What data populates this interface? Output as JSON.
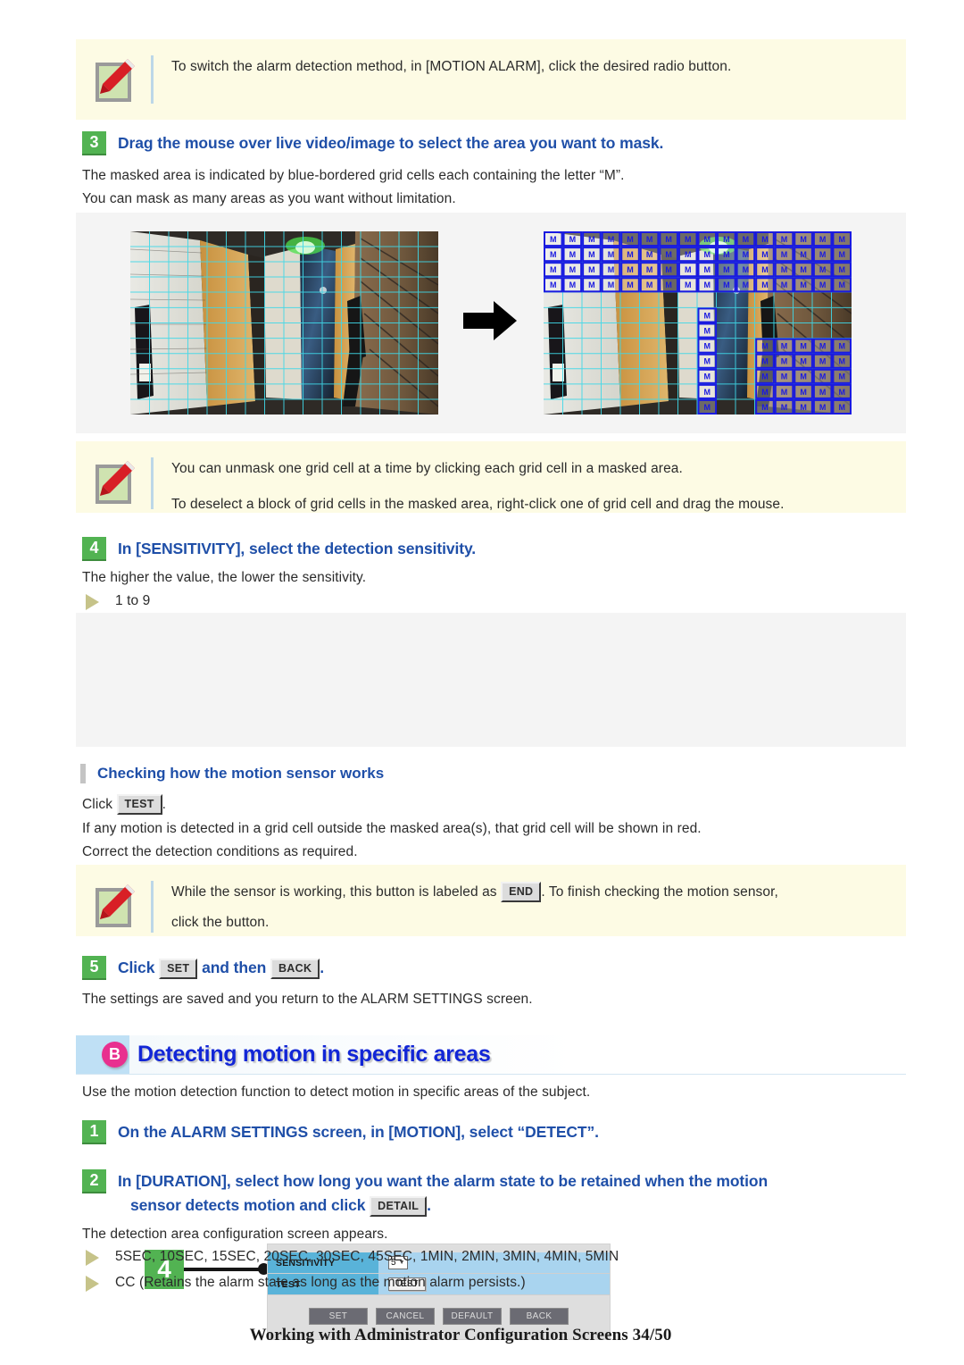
{
  "notes": [
    {
      "id": "note-radio-button",
      "icon": "pencil-note-icon",
      "lines": [
        "To switch the alarm detection method, in [MOTION ALARM], click the desired radio button."
      ]
    },
    {
      "id": "note-unmask",
      "icon": "pencil-note-icon",
      "lines": [
        "You can unmask one grid cell at a time by clicking each grid cell in a masked area.",
        "To deselect a block of grid cells in the masked area, right-click one of grid cell and drag the mouse."
      ]
    },
    {
      "id": "note-end-button",
      "icon": "pencil-note-icon",
      "line_before": "While the sensor is working, this button is labeled as",
      "button": "END",
      "line_after": ". To finish checking the motion sensor,",
      "line2": "click the button."
    }
  ],
  "step3": {
    "number": "3",
    "title": "Drag the mouse over live video/image to select the area you want to mask.",
    "body": [
      "The masked area is indicated by blue-bordered grid cells each containing the letter “M”.",
      "You can mask as many areas as you want without limitation."
    ]
  },
  "figure_masking": {
    "name": "masking-example-figure",
    "left_caption": "live video with detection grid",
    "right_caption": "live video with masked cells marked M",
    "arrow": "right-arrow-icon",
    "mask_letter": "M",
    "grid_cols": 16,
    "grid_rows": 12
  },
  "step4": {
    "number": "4",
    "title": "In [SENSITIVITY], select the detection sensitivity.",
    "body": [
      "The higher the value, the lower the sensitivity."
    ],
    "bullets": [
      "1 to 9"
    ]
  },
  "sensitivity_panel": {
    "callout": "4",
    "rows": [
      {
        "label": "SENSITIVITY",
        "control": "select",
        "value": "5"
      },
      {
        "label": "TEST",
        "control": "button",
        "value": "TEST"
      }
    ],
    "actions": [
      "SET",
      "CANCEL",
      "DEFAULT",
      "BACK"
    ]
  },
  "checking_section": {
    "heading": "Checking how the motion sensor works",
    "click_label": "Click",
    "click_button": "TEST",
    "click_period": ".",
    "body": [
      "If any motion is detected in a grid cell outside the masked area(s), that grid cell will be shown in red.",
      "Correct the detection conditions as required."
    ]
  },
  "step5": {
    "number": "5",
    "title_a": "Click",
    "button_a": "SET",
    "title_b": "and then",
    "button_b": "BACK",
    "title_c": ".",
    "body": [
      "The settings are saved and you return to the ALARM SETTINGS screen."
    ]
  },
  "section_b": {
    "badge": "B",
    "title": "Detecting motion in specific areas",
    "intro": "Use the motion detection function to detect motion in specific areas of the subject."
  },
  "stepB1": {
    "number": "1",
    "title": "On the ALARM SETTINGS screen, in [MOTION], select “DETECT”."
  },
  "stepB2": {
    "number": "2",
    "title_line1": "In [DURATION], select how long you want the alarm state to be retained when the motion",
    "title_line2": "sensor detects motion and click",
    "button": "DETAIL",
    "title_after": ".",
    "body": [
      "The detection area configuration screen appears."
    ],
    "bullets": [
      "5SEC, 10SEC, 15SEC, 20SEC, 30SEC, 45SEC, 1MIN, 2MIN, 3MIN, 4MIN, 5MIN",
      "CC (Retains the alarm state as long as the motion alarm persists.)"
    ]
  },
  "footer": {
    "text": "Working with Administrator Configuration Screens 34/50"
  },
  "colors": {
    "step_badge": "#52b352",
    "heading_blue": "#1f4fa8",
    "banner_blue": "#1226d6",
    "banner_badge_pink": "#e8308f",
    "note_bg": "#fdfbe4",
    "mask_border": "#1a1ae0",
    "grid_line": "#3fd8e8",
    "panel_label": "#59b3d9",
    "panel_value": "#a9d4ef"
  }
}
